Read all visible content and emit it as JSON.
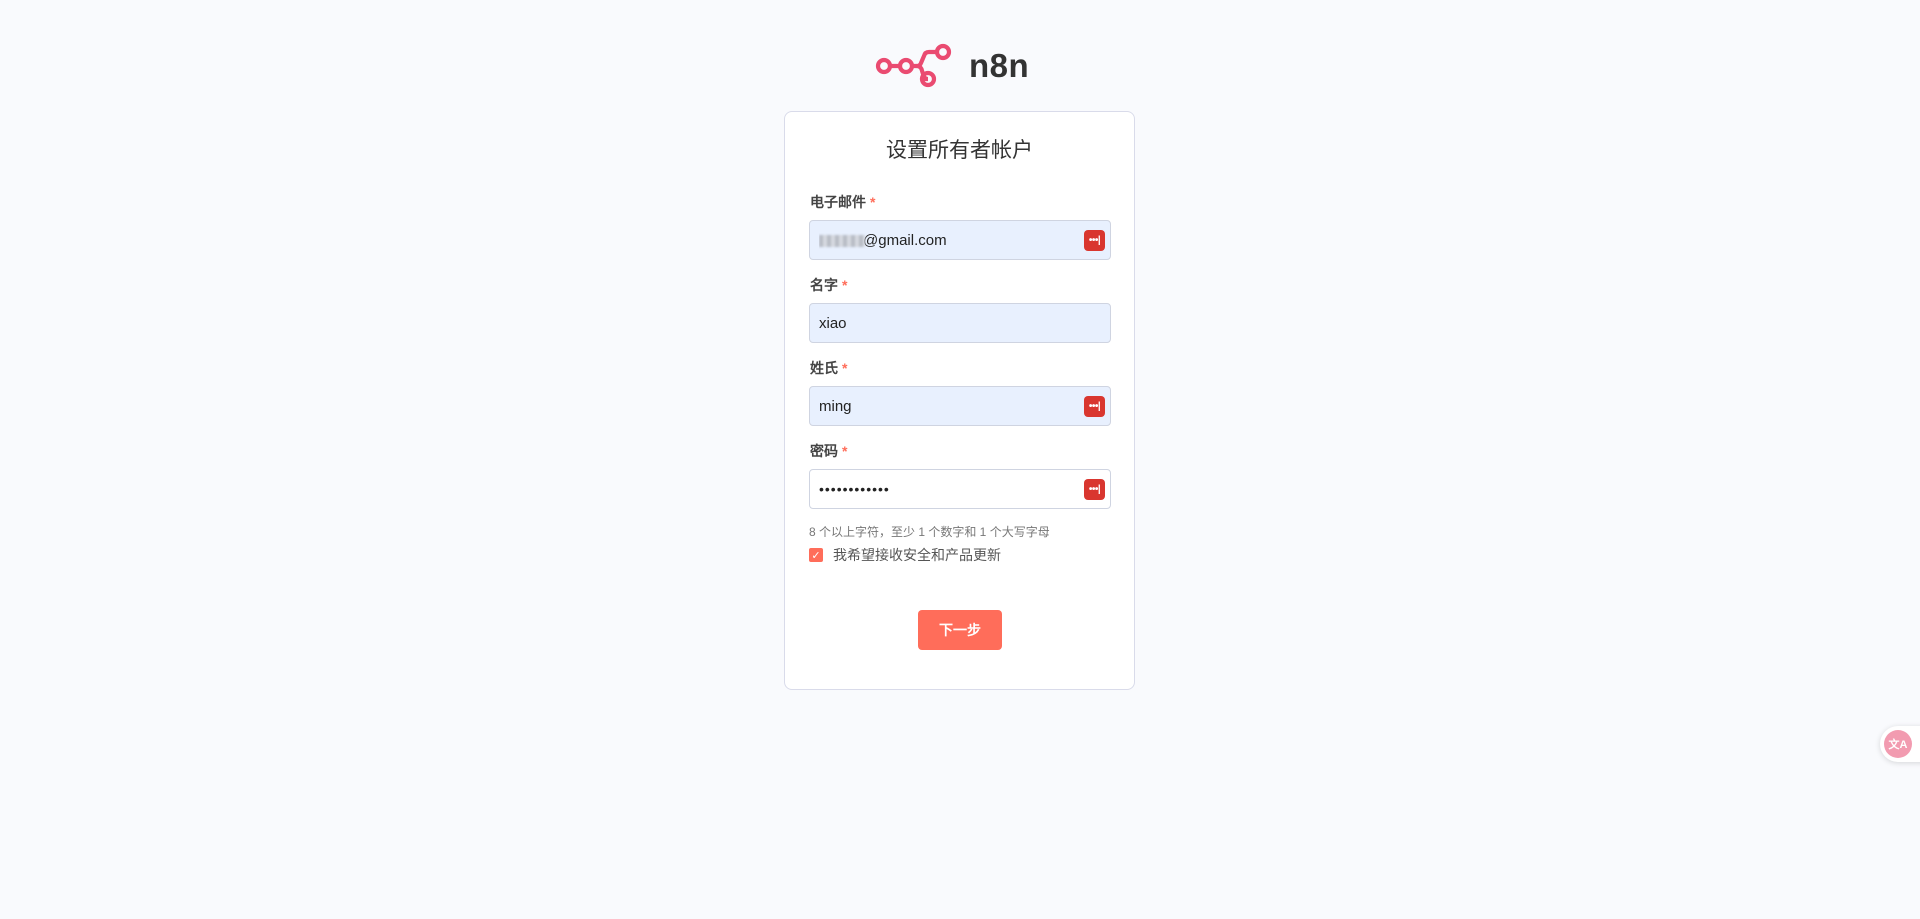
{
  "brand": {
    "name": "n8n",
    "logo_icon": "n8n-logo-icon",
    "logo_color": "#ea4b71"
  },
  "form": {
    "title": "设置所有者帐户",
    "fields": {
      "email": {
        "label": "电子邮件",
        "required_mark": "*",
        "value": "@gmail.com"
      },
      "first_name": {
        "label": "名字",
        "required_mark": "*",
        "value": "xiao"
      },
      "last_name": {
        "label": "姓氏",
        "required_mark": "*",
        "value": "ming"
      },
      "password": {
        "label": "密码",
        "required_mark": "*",
        "value": "••••••••••••",
        "hint": "8 个以上字符，至少 1 个数字和 1 个大写字母"
      }
    },
    "newsletter_checkbox": {
      "label": "我希望接收安全和产品更新",
      "checked": true
    },
    "submit_label": "下一步"
  },
  "colors": {
    "accent": "#ff6d5a",
    "autofill_bg": "#e8f0fe",
    "password_manager_icon": "#d9362f"
  },
  "password_manager": {
    "icon": "password-manager-icon",
    "glyph": "•••|"
  },
  "translate_widget": {
    "icon": "translate-icon",
    "glyph": "文A"
  }
}
